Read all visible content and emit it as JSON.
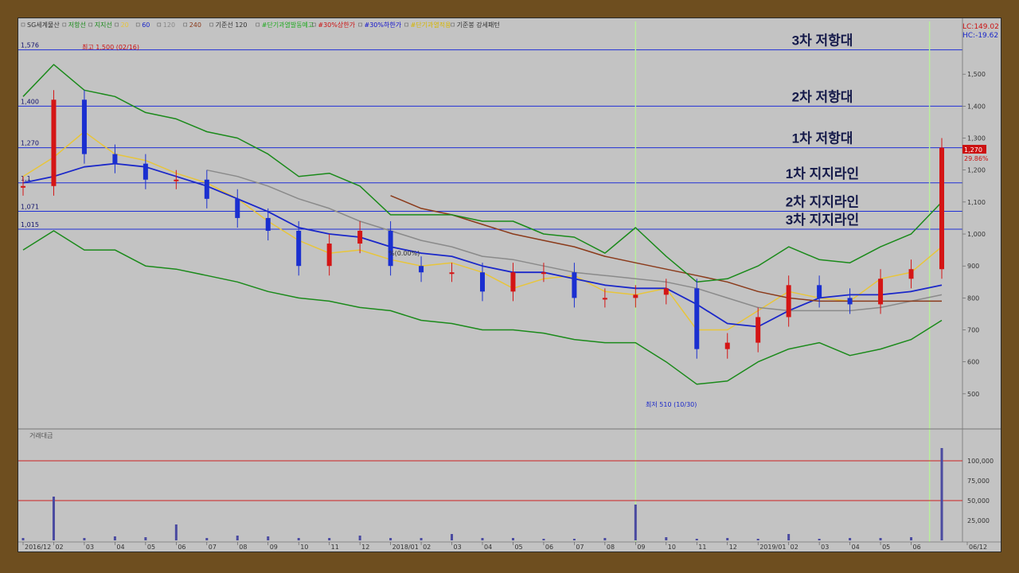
{
  "header": {
    "legend_items": [
      {
        "text": "SG세계물산",
        "color": "#333333"
      },
      {
        "text": "저항선",
        "color": "#1a8a1a"
      },
      {
        "text": "지지선",
        "color": "#1a8a1a"
      },
      {
        "text": "20",
        "color": "#e8c53a"
      },
      {
        "text": "60",
        "color": "#1a27c9"
      },
      {
        "text": "120",
        "color": "#8a8a8a"
      },
      {
        "text": "240",
        "color": "#8b3a1a"
      },
      {
        "text": "기준선 120",
        "color": "#333333"
      },
      {
        "text": "#단기과열발동예고",
        "color": "#22aa22"
      },
      {
        "text": "#30%상한가",
        "color": "#cc1111"
      },
      {
        "text": "#30%하한가",
        "color": "#1111cc"
      },
      {
        "text": "#단기과열적용",
        "color": "#d6b600"
      },
      {
        "text": "기준봉 강세패턴",
        "color": "#333333"
      }
    ],
    "lc_label": "LC:149.02",
    "hc_label": "HC:-19.62",
    "price_tag": "1,270",
    "change_tag": "29.86%",
    "volume_title": "거래대금"
  },
  "annotations": [
    {
      "text": "3차 저항대",
      "value": 1576,
      "color": "#151a4a"
    },
    {
      "text": "2차 저항대",
      "value": 1400,
      "color": "#151a4a"
    },
    {
      "text": "1차 저항대",
      "value": 1270,
      "color": "#151a4a"
    },
    {
      "text": "1차 지지라인",
      "value": 1160,
      "color": "#151a4a"
    },
    {
      "text": "2차 지지라인",
      "value": 1071,
      "color": "#151a4a"
    },
    {
      "text": "3차 지지라인",
      "value": 1015,
      "color": "#151a4a"
    }
  ],
  "level_labels": [
    "1,576",
    "1,400",
    "1,270",
    "1,1",
    "1,071",
    "1,015"
  ],
  "high_label": "최고 1,500 (02/16)",
  "low_label": "최저 510 (10/30)",
  "mid_label": "%(0.00%)",
  "chart_data": {
    "type": "line",
    "title": "SG세계물산",
    "x": [
      "2016/12",
      "02",
      "03",
      "04",
      "05",
      "06",
      "07",
      "08",
      "09",
      "10",
      "11",
      "12",
      "2018/01",
      "02",
      "03",
      "04",
      "05",
      "06",
      "07",
      "08",
      "09",
      "10",
      "11",
      "12",
      "2019/01",
      "02",
      "03",
      "04",
      "05",
      "06",
      "06/12"
    ],
    "yticks": [
      500,
      600,
      700,
      800,
      900,
      1000,
      1100,
      1200,
      1300,
      1400,
      1500
    ],
    "ylim": [
      430,
      1600
    ],
    "horizontal_levels": [
      1576,
      1400,
      1270,
      1160,
      1071,
      1015
    ],
    "series": [
      {
        "name": "20",
        "color": "#e8c53a",
        "values": [
          1180,
          1240,
          1320,
          1250,
          1230,
          1190,
          1160,
          1110,
          1040,
          980,
          940,
          950,
          920,
          900,
          910,
          880,
          830,
          860,
          870,
          820,
          810,
          830,
          700,
          700,
          760,
          820,
          800,
          790,
          860,
          880,
          960
        ]
      },
      {
        "name": "60",
        "color": "#1a27c9",
        "values": [
          1160,
          1180,
          1210,
          1220,
          1210,
          1180,
          1150,
          1110,
          1070,
          1020,
          1000,
          990,
          960,
          940,
          930,
          900,
          880,
          880,
          860,
          840,
          830,
          830,
          780,
          720,
          710,
          760,
          800,
          810,
          810,
          820,
          840
        ]
      },
      {
        "name": "120",
        "color": "#8a8a8a",
        "values": [
          null,
          null,
          null,
          null,
          null,
          null,
          1200,
          1180,
          1150,
          1110,
          1080,
          1040,
          1010,
          980,
          960,
          930,
          920,
          900,
          880,
          870,
          860,
          850,
          830,
          800,
          770,
          760,
          760,
          760,
          770,
          790,
          810
        ]
      },
      {
        "name": "240",
        "color": "#8b3a1a",
        "values": [
          null,
          null,
          null,
          null,
          null,
          null,
          null,
          null,
          null,
          null,
          null,
          null,
          1120,
          1080,
          1060,
          1030,
          1000,
          980,
          960,
          930,
          910,
          890,
          870,
          850,
          820,
          800,
          790,
          790,
          790,
          790,
          790
        ]
      },
      {
        "name": "저항선",
        "color": "#1a8a1a",
        "values": [
          1430,
          1530,
          1450,
          1430,
          1380,
          1360,
          1320,
          1300,
          1250,
          1180,
          1190,
          1150,
          1060,
          1060,
          1060,
          1040,
          1040,
          1000,
          990,
          940,
          1020,
          930,
          850,
          860,
          900,
          960,
          920,
          910,
          960,
          1000,
          1100
        ]
      },
      {
        "name": "지지선",
        "color": "#1a8a1a",
        "values": [
          950,
          1010,
          950,
          950,
          900,
          890,
          870,
          850,
          820,
          800,
          790,
          770,
          760,
          730,
          720,
          700,
          700,
          690,
          670,
          660,
          660,
          600,
          530,
          540,
          600,
          640,
          660,
          620,
          640,
          670,
          730
        ]
      }
    ],
    "close": [
      1150,
      1420,
      1250,
      1220,
      1170,
      1170,
      1110,
      1050,
      1010,
      900,
      970,
      1010,
      900,
      880,
      880,
      820,
      880,
      880,
      800,
      800,
      810,
      830,
      640,
      660,
      740,
      840,
      800,
      780,
      860,
      890,
      1270
    ],
    "volume": {
      "ylim": [
        0,
        120000
      ],
      "yticks": [
        25000,
        50000,
        75000,
        100000
      ],
      "reference_lines": [
        100000,
        50000
      ],
      "values": [
        3000,
        55000,
        3000,
        5000,
        4000,
        20000,
        3000,
        6000,
        5000,
        3000,
        3000,
        6000,
        3000,
        3000,
        8000,
        3000,
        3000,
        2000,
        2000,
        3000,
        45000,
        4000,
        2000,
        3000,
        2000,
        8000,
        2000,
        3000,
        3000,
        4000,
        116000
      ]
    }
  }
}
